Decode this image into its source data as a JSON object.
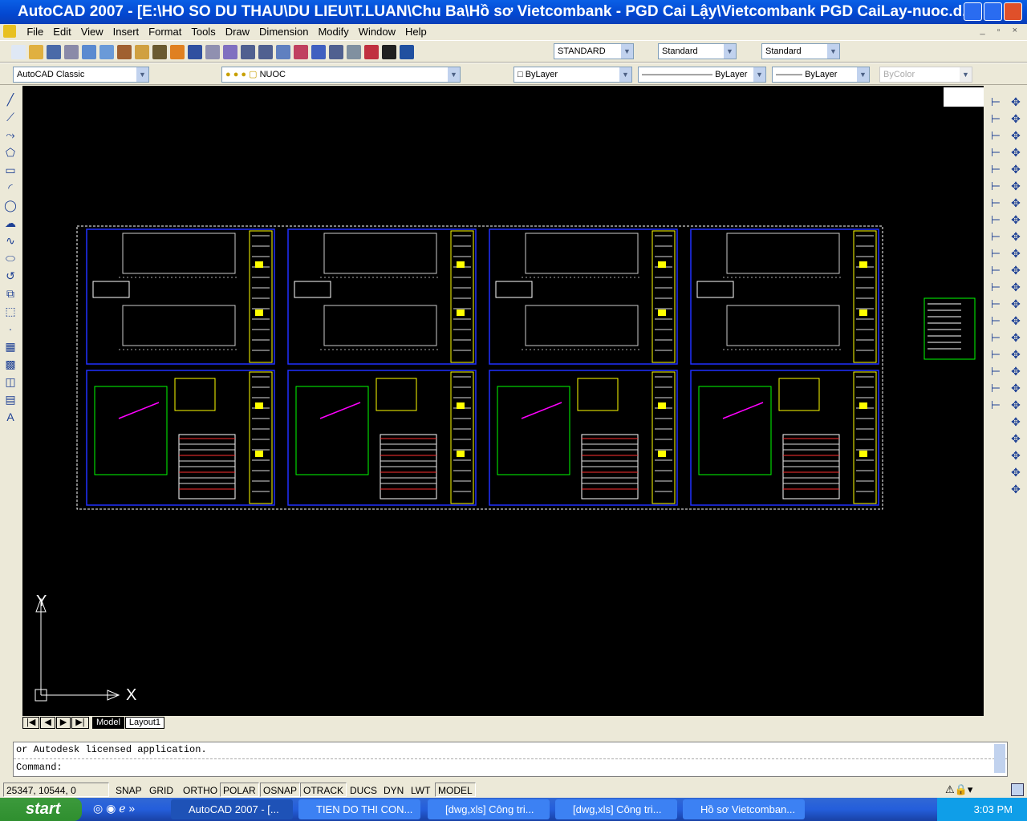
{
  "window": {
    "title": "AutoCAD 2007 - [E:\\HO SO DU THAU\\DU LIEU\\T.LUAN\\Chu Ba\\Hồ sơ Vietcombank - PGD Cai Lậy\\Vietcombank PGD CaiLay-nuoc.d..."
  },
  "menu": [
    "File",
    "Edit",
    "View",
    "Insert",
    "Format",
    "Tools",
    "Draw",
    "Dimension",
    "Modify",
    "Window",
    "Help"
  ],
  "styles": {
    "text_style": "STANDARD",
    "dim_style": "Standard",
    "table_style": "Standard"
  },
  "workspace": "AutoCAD Classic",
  "layer": "NUOC",
  "properties": {
    "color": "ByLayer",
    "linetype": "ByLayer",
    "lineweight": "ByLayer",
    "plotstyle": "ByColor"
  },
  "ucs": {
    "x": "X",
    "y": "Y"
  },
  "tabs": [
    "Model",
    "Layout1"
  ],
  "command": {
    "history": "or Autodesk licensed application.",
    "prompt": "Command:"
  },
  "status": {
    "coords": "25347, 10544, 0",
    "toggles": [
      {
        "label": "SNAP",
        "on": false
      },
      {
        "label": "GRID",
        "on": false
      },
      {
        "label": "ORTHO",
        "on": false
      },
      {
        "label": "POLAR",
        "on": true
      },
      {
        "label": "OSNAP",
        "on": true
      },
      {
        "label": "OTRACK",
        "on": true
      },
      {
        "label": "DUCS",
        "on": false
      },
      {
        "label": "DYN",
        "on": false
      },
      {
        "label": "LWT",
        "on": false
      },
      {
        "label": "MODEL",
        "on": true
      }
    ]
  },
  "taskbar": {
    "start": "start",
    "tasks": [
      "AutoCAD 2007 - [...",
      "TIEN DO THI CON...",
      "[dwg,xls] Công tri...",
      "[dwg,xls] Công tri...",
      "Hồ sơ Vietcomban..."
    ],
    "clock": "3:03 PM"
  }
}
